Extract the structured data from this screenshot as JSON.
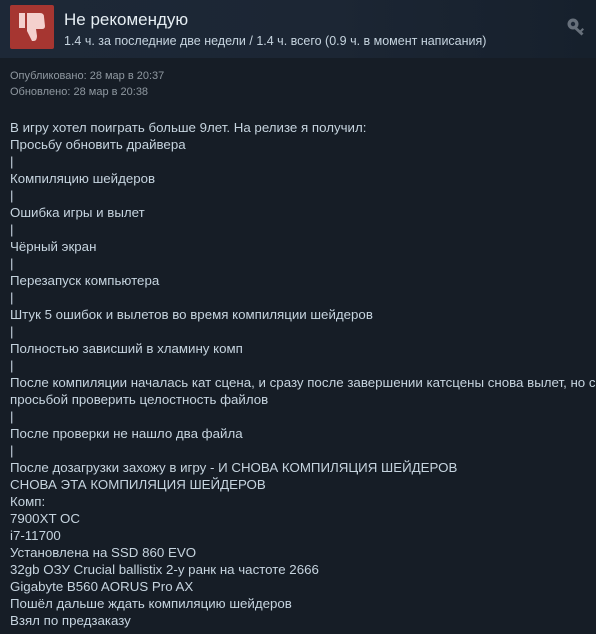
{
  "header": {
    "verdict": "Не рекомендую",
    "playtime": "1.4 ч. за последние две недели / 1.4 ч. всего (0.9 ч. в момент написания)",
    "verdict_color": "#a63631"
  },
  "dates": {
    "published": "Опубликовано: 28 мар в 20:37",
    "updated": "Обновлено: 28 мар в 20:38"
  },
  "review": {
    "lines": [
      "В игру хотел поиграть больше 9лет. На релизе я получил:",
      "Просьбу обновить драйвера",
      "|",
      "Компиляцию шейдеров",
      "|",
      "Ошибка игры и вылет",
      "|",
      "Чёрный экран",
      "|",
      "Перезапуск компьютера",
      "|",
      "Штук 5 ошибок и вылетов во время компиляции шейдеров",
      "|",
      "Полностью зависший в хламину комп",
      "|",
      "После компиляции началась кат сцена, и сразу после завершении катсцены снова вылет, но с",
      "просьбой проверить целостность файлов",
      "|",
      "После проверки не нашло два файла",
      "|",
      "После дозагрузки захожу в игру - И СНОВА КОМПИЛЯЦИЯ ШЕЙДЕРОВ",
      "СНОВА ЭТА КОМПИЛЯЦИЯ ШЕЙДЕРОВ",
      "Комп:",
      "7900XT OC",
      "i7-11700",
      "Установлена на SSD 860 EVO",
      "32gb ОЗУ Crucial ballistix 2-у ранк на частоте 2666",
      "Gigabyte B560 AORUS Pro AX",
      "Пошёл дальше ждать компиляцию шейдеров",
      "Взял по предзаказу"
    ]
  },
  "icons": {
    "verdict_icon": "thumbs-down-icon",
    "award_icon": "award-icon"
  }
}
